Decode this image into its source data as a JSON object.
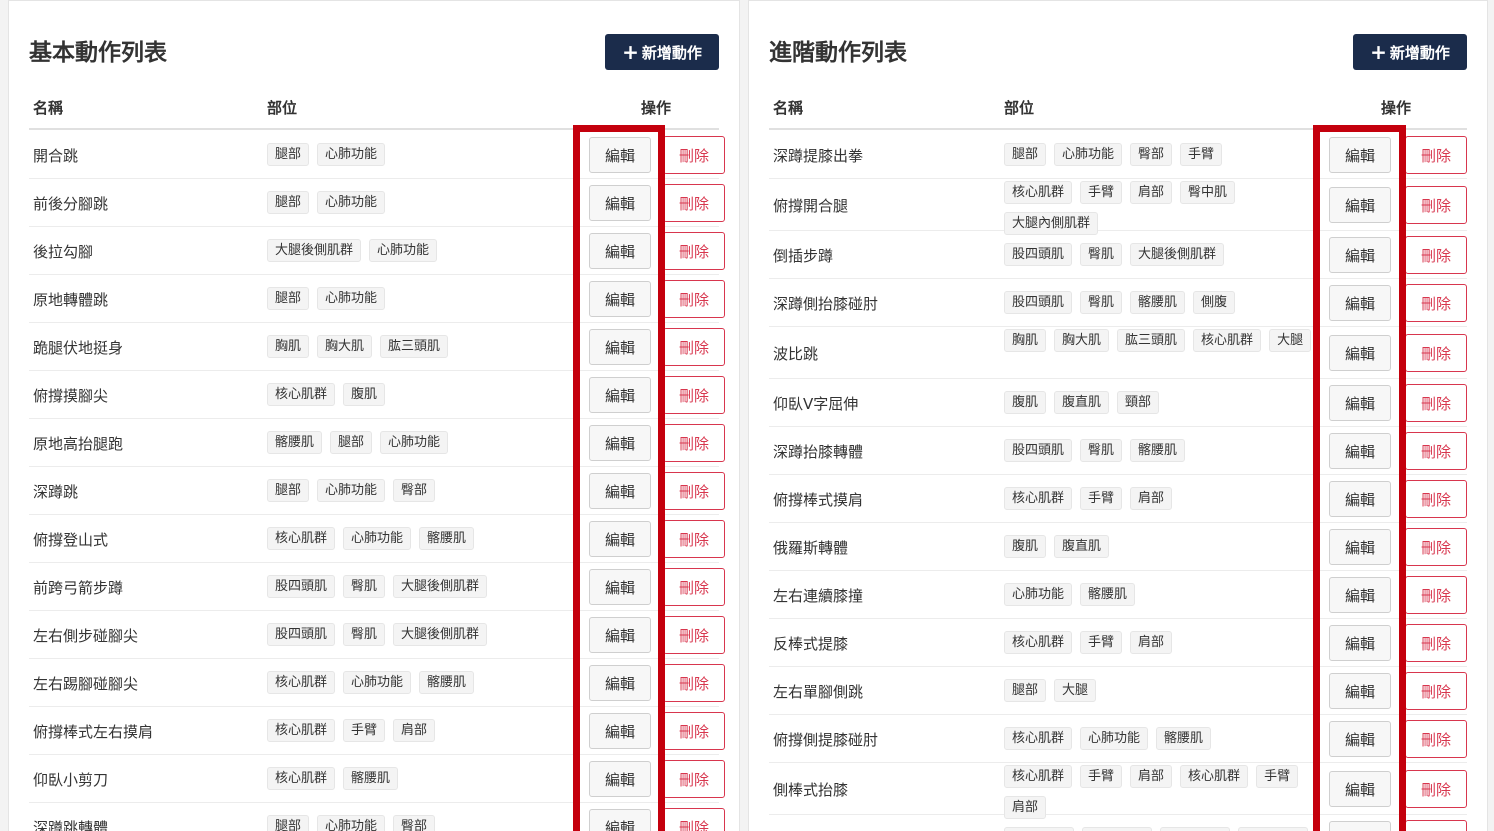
{
  "basic": {
    "title": "基本動作列表",
    "add_label": "新增動作",
    "headers": {
      "name": "名稱",
      "part": "部位",
      "action": "操作"
    },
    "edit_label": "編輯",
    "delete_label": "刪除",
    "rows": [
      {
        "name": "開合跳",
        "tags": [
          "腿部",
          "心肺功能"
        ]
      },
      {
        "name": "前後分腳跳",
        "tags": [
          "腿部",
          "心肺功能"
        ]
      },
      {
        "name": "後拉勾腳",
        "tags": [
          "大腿後側肌群",
          "心肺功能"
        ]
      },
      {
        "name": "原地轉體跳",
        "tags": [
          "腿部",
          "心肺功能"
        ]
      },
      {
        "name": "跪腿伏地挺身",
        "tags": [
          "胸肌",
          "胸大肌",
          "肱三頭肌"
        ]
      },
      {
        "name": "俯撐摸腳尖",
        "tags": [
          "核心肌群",
          "腹肌"
        ]
      },
      {
        "name": "原地高抬腿跑",
        "tags": [
          "髂腰肌",
          "腿部",
          "心肺功能"
        ]
      },
      {
        "name": "深蹲跳",
        "tags": [
          "腿部",
          "心肺功能",
          "臀部"
        ]
      },
      {
        "name": "俯撐登山式",
        "tags": [
          "核心肌群",
          "心肺功能",
          "髂腰肌"
        ]
      },
      {
        "name": "前跨弓箭步蹲",
        "tags": [
          "股四頭肌",
          "臀肌",
          "大腿後側肌群"
        ]
      },
      {
        "name": "左右側步碰腳尖",
        "tags": [
          "股四頭肌",
          "臀肌",
          "大腿後側肌群"
        ]
      },
      {
        "name": "左右踢腳碰腳尖",
        "tags": [
          "核心肌群",
          "心肺功能",
          "髂腰肌"
        ]
      },
      {
        "name": "俯撐棒式左右摸肩",
        "tags": [
          "核心肌群",
          "手臂",
          "肩部"
        ]
      },
      {
        "name": "仰臥小剪刀",
        "tags": [
          "核心肌群",
          "髂腰肌"
        ]
      },
      {
        "name": "深蹲跳轉體",
        "tags": [
          "腿部",
          "心肺功能",
          "臀部"
        ]
      }
    ]
  },
  "advanced": {
    "title": "進階動作列表",
    "add_label": "新增動作",
    "headers": {
      "name": "名稱",
      "part": "部位",
      "action": "操作"
    },
    "edit_label": "編輯",
    "delete_label": "刪除",
    "rows": [
      {
        "name": "深蹲提膝出拳",
        "tags": [
          "腿部",
          "心肺功能",
          "臀部",
          "手臂"
        ]
      },
      {
        "name": "俯撐開合腿",
        "tags": [
          "核心肌群",
          "手臂",
          "肩部",
          "臀中肌",
          "大腿內側肌群"
        ]
      },
      {
        "name": "倒插步蹲",
        "tags": [
          "股四頭肌",
          "臀肌",
          "大腿後側肌群"
        ]
      },
      {
        "name": "深蹲側抬膝碰肘",
        "tags": [
          "股四頭肌",
          "臀肌",
          "髂腰肌",
          "側腹"
        ]
      },
      {
        "name": "波比跳",
        "tags": [
          "胸肌",
          "胸大肌",
          "肱三頭肌",
          "核心肌群",
          "大腿"
        ]
      },
      {
        "name": "仰臥V字屈伸",
        "tags": [
          "腹肌",
          "腹直肌",
          "頸部"
        ]
      },
      {
        "name": "深蹲抬膝轉體",
        "tags": [
          "股四頭肌",
          "臀肌",
          "髂腰肌"
        ]
      },
      {
        "name": "俯撐棒式摸肩",
        "tags": [
          "核心肌群",
          "手臂",
          "肩部"
        ]
      },
      {
        "name": "俄羅斯轉體",
        "tags": [
          "腹肌",
          "腹直肌"
        ]
      },
      {
        "name": "左右連續膝撞",
        "tags": [
          "心肺功能",
          "髂腰肌"
        ]
      },
      {
        "name": "反棒式提膝",
        "tags": [
          "核心肌群",
          "手臂",
          "肩部"
        ]
      },
      {
        "name": "左右單腳側跳",
        "tags": [
          "腿部",
          "大腿"
        ]
      },
      {
        "name": "俯撐側提膝碰肘",
        "tags": [
          "核心肌群",
          "心肺功能",
          "髂腰肌"
        ]
      },
      {
        "name": "側棒式抬膝",
        "tags": [
          "核心肌群",
          "手臂",
          "肩部",
          "核心肌群",
          "手臂",
          "肩部"
        ]
      },
      {
        "name": "",
        "tags": [
          "",
          "",
          "",
          ""
        ]
      }
    ]
  }
}
